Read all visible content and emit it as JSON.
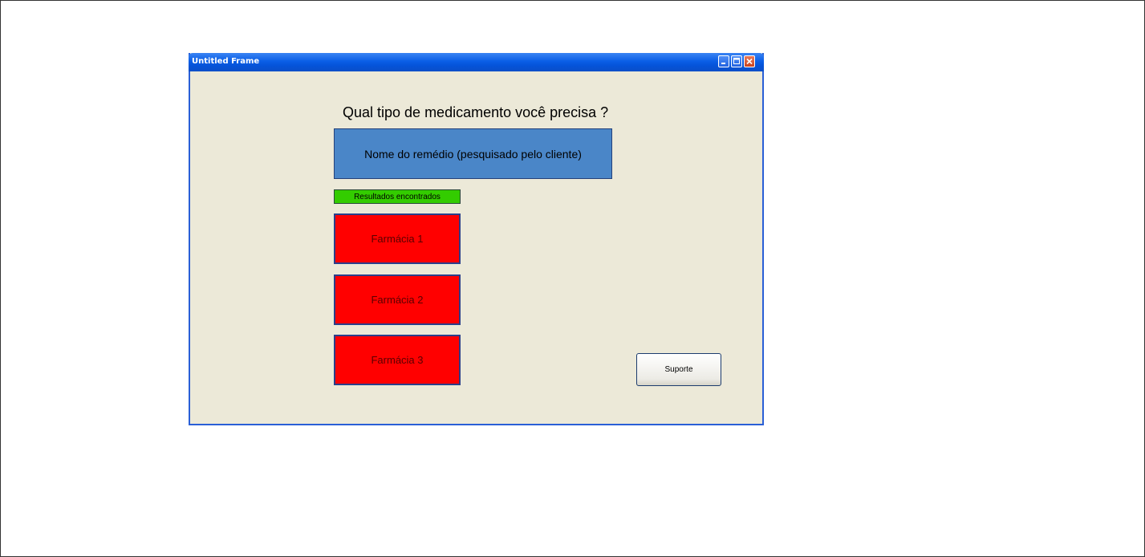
{
  "window": {
    "title": "Untitled Frame",
    "controls": [
      "minimize-icon",
      "maximize-icon",
      "close-icon"
    ]
  },
  "main": {
    "question": "Qual tipo de medicamento você precisa ?",
    "search_text": "Nome do remédio (pesquisado pelo cliente)",
    "results_label": "Resultados encontrados",
    "pharmacies": [
      "Farmácia 1",
      "Farmácia 2",
      "Farmácia 3"
    ],
    "support_label": "Suporte"
  },
  "colors": {
    "window_bg": "#ece9d8",
    "titlebar": "#0a5ee6",
    "search_box": "#4a86c8",
    "results_label": "#33cc00",
    "pharmacy": "#ff0000"
  }
}
